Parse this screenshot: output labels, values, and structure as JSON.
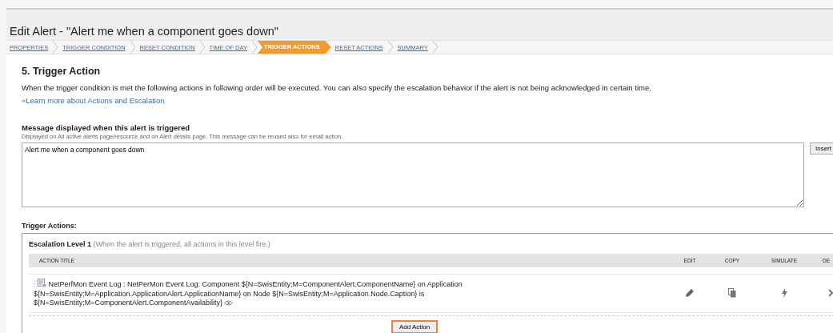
{
  "window": {
    "title": "Edit Alert - \"Alert me when a component goes down\""
  },
  "steps": [
    {
      "label": "PROPERTIES",
      "selected": false
    },
    {
      "label": "TRIGGER CONDITION",
      "selected": false
    },
    {
      "label": "RESET CONDITION",
      "selected": false
    },
    {
      "label": "TIME OF DAY",
      "selected": false
    },
    {
      "label": "TRIGGER ACTIONS",
      "selected": true
    },
    {
      "label": "RESET ACTIONS",
      "selected": false
    },
    {
      "label": "SUMMARY",
      "selected": false
    }
  ],
  "section": {
    "heading": "5. Trigger Action",
    "description": "When the trigger condition is met the following actions in following order will be executed. You can also specify the escalation behavior if the alert is not being acknowledged in certain time.",
    "link": "»Learn more about Actions and Escalation"
  },
  "message": {
    "label": "Message displayed when this alert is triggered",
    "hint": "Displayed on All active alerts page/resource and on Alert details page. This message can be reused also for email action.",
    "value": "Alert me when a component goes down",
    "insert_button": "Insert"
  },
  "trigger_actions": {
    "label": "Trigger Actions:",
    "escalation": {
      "title": "Escalation Level 1",
      "note": "(When the alert is triggered, all actions in this level fire.)"
    },
    "columns": [
      "ACTION TITLE",
      "EDIT",
      "COPY",
      "SIMULATE",
      "DE"
    ],
    "rows": [
      {
        "title": "NetPerfMon Event Log : NetPerMon Event Log: Component ${N=SwisEntity;M=ComponentAlert.ComponentName} on Application ${N=SwisEntity;M=Application.ApplicationAlert.ApplicationName} on Node ${N=SwisEntity;M=Application.Node.Caption} is ${N=SwisEntity;M=ComponentAlert.ComponentAvailability}"
      }
    ],
    "add_button": "Add Action"
  }
}
